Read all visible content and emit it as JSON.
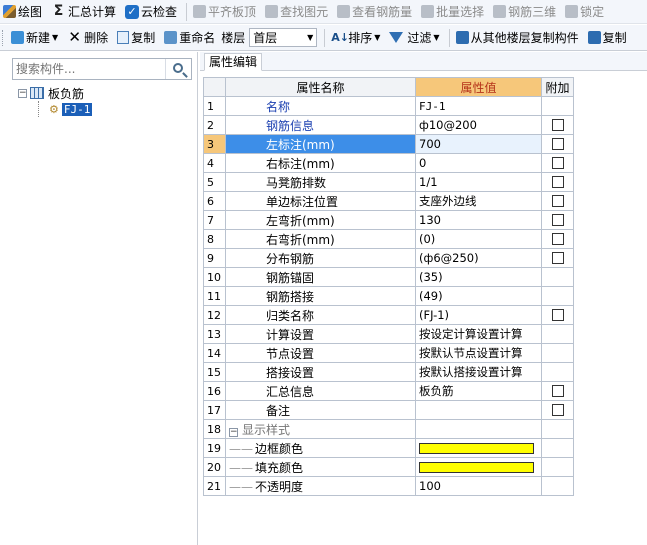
{
  "toolbar_top": {
    "items": [
      {
        "label": "绘图",
        "icon": "draw-icon",
        "enabled": true
      },
      {
        "label": "汇总计算",
        "icon": "sigma-icon",
        "enabled": true
      },
      {
        "label": "云检查",
        "icon": "cloud-check-icon",
        "enabled": true
      },
      {
        "label": "平齐板顶",
        "icon": "align-slab-top-icon",
        "enabled": false
      },
      {
        "label": "查找图元",
        "icon": "find-element-icon",
        "enabled": false
      },
      {
        "label": "查看钢筋量",
        "icon": "view-rebar-icon",
        "enabled": false
      },
      {
        "label": "批量选择",
        "icon": "batch-select-icon",
        "enabled": false
      },
      {
        "label": "钢筋三维",
        "icon": "rebar-3d-icon",
        "enabled": false
      },
      {
        "label": "锁定",
        "icon": "lock-icon",
        "enabled": false
      }
    ]
  },
  "toolbar_main": {
    "new_label": "新建",
    "delete_label": "删除",
    "copy_label": "复制",
    "rename_label": "重命名",
    "floor_label": "楼层",
    "floor_value": "首层",
    "sort_label": "排序",
    "filter_label": "过滤",
    "copy_from_floor_label": "从其他楼层复制构件",
    "copy2_label": "复制"
  },
  "search": {
    "placeholder": "搜索构件..."
  },
  "tree": {
    "root_label": "板负筋",
    "root_toggle": "−",
    "child_label": "FJ-1"
  },
  "tab": {
    "label": "属性编辑"
  },
  "grid": {
    "headers": {
      "name": "属性名称",
      "value": "属性值",
      "extra": "附加"
    },
    "rows": [
      {
        "no": "1",
        "name": "名称",
        "value": "FJ-1",
        "checkbox": false,
        "blue": true,
        "mono": true
      },
      {
        "no": "2",
        "name": "钢筋信息",
        "value": "ф10@200",
        "checkbox": true,
        "blue": true
      },
      {
        "no": "3",
        "name": "左标注(mm)",
        "value": "700",
        "checkbox": true,
        "selected": true
      },
      {
        "no": "4",
        "name": "右标注(mm)",
        "value": "0",
        "checkbox": true
      },
      {
        "no": "5",
        "name": "马凳筋排数",
        "value": "1/1",
        "checkbox": true
      },
      {
        "no": "6",
        "name": "单边标注位置",
        "value": "支座外边线",
        "checkbox": true
      },
      {
        "no": "7",
        "name": "左弯折(mm)",
        "value": "130",
        "checkbox": true
      },
      {
        "no": "8",
        "name": "右弯折(mm)",
        "value": "(0)",
        "checkbox": true
      },
      {
        "no": "9",
        "name": "分布钢筋",
        "value": "(ф6@250)",
        "checkbox": true
      },
      {
        "no": "10",
        "name": "钢筋锚固",
        "value": "(35)",
        "checkbox": false
      },
      {
        "no": "11",
        "name": "钢筋搭接",
        "value": "(49)",
        "checkbox": false
      },
      {
        "no": "12",
        "name": "归类名称",
        "value": "(FJ-1)",
        "checkbox": true
      },
      {
        "no": "13",
        "name": "计算设置",
        "value": "按设定计算设置计算",
        "checkbox": false
      },
      {
        "no": "14",
        "name": "节点设置",
        "value": "按默认节点设置计算",
        "checkbox": false
      },
      {
        "no": "15",
        "name": "搭接设置",
        "value": "按默认搭接设置计算",
        "checkbox": false
      },
      {
        "no": "16",
        "name": "汇总信息",
        "value": "板负筋",
        "checkbox": true
      },
      {
        "no": "17",
        "name": "备注",
        "value": "",
        "checkbox": true
      }
    ],
    "group": {
      "no": "18",
      "toggle": "−",
      "name": "显示样式"
    },
    "group_rows": [
      {
        "no": "19",
        "name": "边框颜色",
        "swatch": "#ffff00"
      },
      {
        "no": "20",
        "name": "填充颜色",
        "swatch": "#ffff00"
      },
      {
        "no": "21",
        "name": "不透明度",
        "value": "100"
      }
    ]
  },
  "colors": {
    "selected_row": "#3d8ee8",
    "value_header": "#f6c77a",
    "swatch": "#ffff00"
  }
}
